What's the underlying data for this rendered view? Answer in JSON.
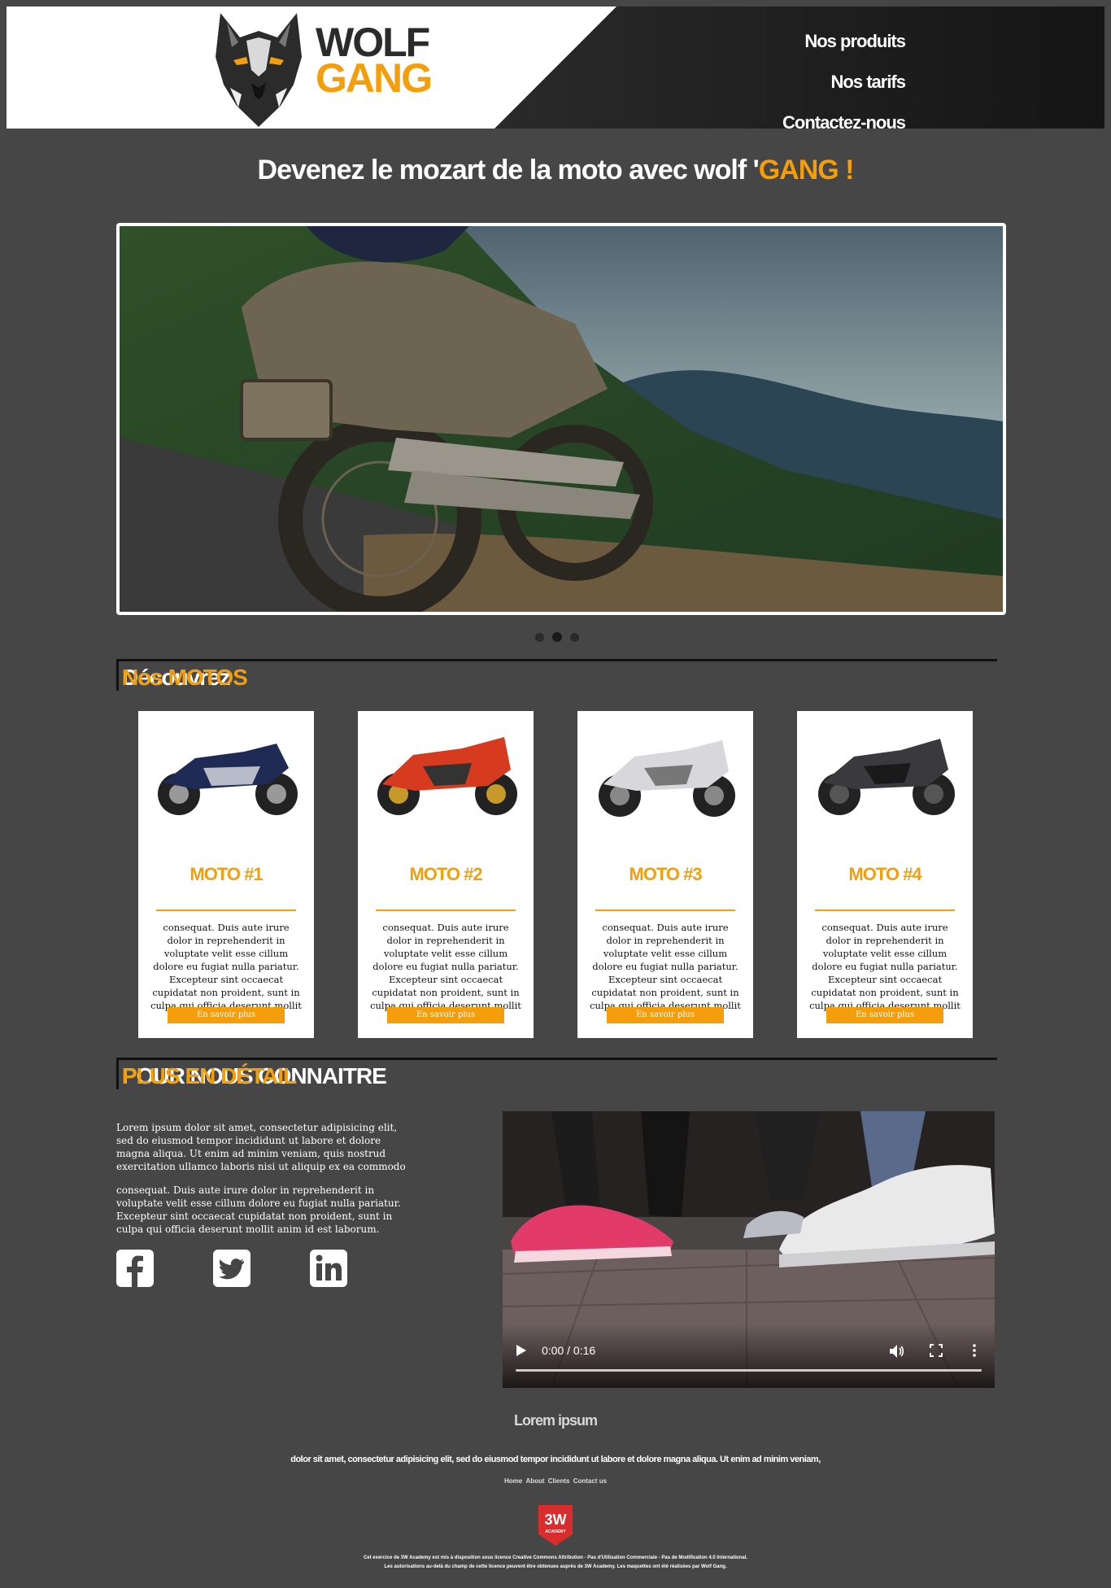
{
  "brand": {
    "line1": "WOLF",
    "line2": "GANG"
  },
  "nav": [
    {
      "label": "Nos produits"
    },
    {
      "label": "Nos tarifs"
    },
    {
      "label": "Contactez-nous"
    }
  ],
  "hero": {
    "title_prefix": "Devenez le mozart de la moto avec wolf '",
    "title_accent": "GANG !"
  },
  "slider": {
    "slides": 3,
    "active_index": 1
  },
  "motos_section": {
    "heading_plain": "Découvrez ",
    "heading_accent": "Nos MOTOS"
  },
  "cards": [
    {
      "title": "MOTO #1",
      "text": "consequat. Duis aute irure dolor in reprehenderit in voluptate velit esse cillum dolore eu fugiat nulla pariatur. Excepteur sint occaecat cupidatat non proident, sunt in culpa qui officia deserunt mollit anim id est laborum.",
      "button": "En savoir plus"
    },
    {
      "title": "MOTO #2",
      "text": "consequat. Duis aute irure dolor in reprehenderit in voluptate velit esse cillum dolore eu fugiat nulla pariatur. Excepteur sint occaecat cupidatat non proident, sunt in culpa qui officia deserunt mollit anim id est laborum.",
      "button": "En savoir plus"
    },
    {
      "title": "MOTO #3",
      "text": "consequat. Duis aute irure dolor in reprehenderit in voluptate velit esse cillum dolore eu fugiat nulla pariatur. Excepteur sint occaecat cupidatat non proident, sunt in culpa qui officia deserunt mollit anim id est laborum.",
      "button": "En savoir plus"
    },
    {
      "title": "MOTO #4",
      "text": "consequat. Duis aute irure dolor in reprehenderit in voluptate velit esse cillum dolore eu fugiat nulla pariatur. Excepteur sint occaecat cupidatat non proident, sunt in culpa qui officia deserunt mollit anim id est laborum.",
      "button": "En savoir plus"
    }
  ],
  "about": {
    "heading_plain": "POUR NOUS CONNAITRE ",
    "heading_accent": "PLUS EN DÉTAIL",
    "p1": "Lorem ipsum dolor sit amet, consectetur adipisicing elit, sed do eiusmod tempor incididunt ut labore et dolore magna aliqua. Ut enim ad minim veniam, quis nostrud exercitation ullamco laboris nisi ut aliquip ex ea commodo",
    "p2": "consequat. Duis aute irure dolor in reprehenderit in voluptate velit esse cillum dolore eu fugiat nulla pariatur. Excepteur sint occaecat cupidatat non proident, sunt in culpa qui officia deserunt mollit anim id est laborum.",
    "social": [
      "facebook-icon",
      "twitter-icon",
      "linkedin-icon"
    ]
  },
  "video": {
    "time": "0:00 / 0:16"
  },
  "footer": {
    "title": "Lorem ipsum",
    "text": "dolor sit amet, consectetur adipisicing elit, sed do eiusmod tempor incididunt ut labore et dolore magna aliqua. Ut enim ad minim veniam,",
    "links": [
      "Home",
      "About",
      "Clients",
      "Contact us"
    ],
    "badge_line1": "3W",
    "badge_line2": "ACADEMY",
    "credits_line1": "Cet exercice de 3W Academy est mis à disposition sous licence Creative Commons Attribution - Pas d'Utilisation Commerciale - Pas de Modification 4.0 International.",
    "credits_line2": "Les autorisations au-delà du champ de cette licence peuvent être obtenues auprès de 3W Academy. Les maquettes ont été réalisées par Wolf Gang."
  },
  "colors": {
    "accent": "#f59e0b",
    "background": "#464646",
    "header_dark": "#1c1c1c"
  }
}
